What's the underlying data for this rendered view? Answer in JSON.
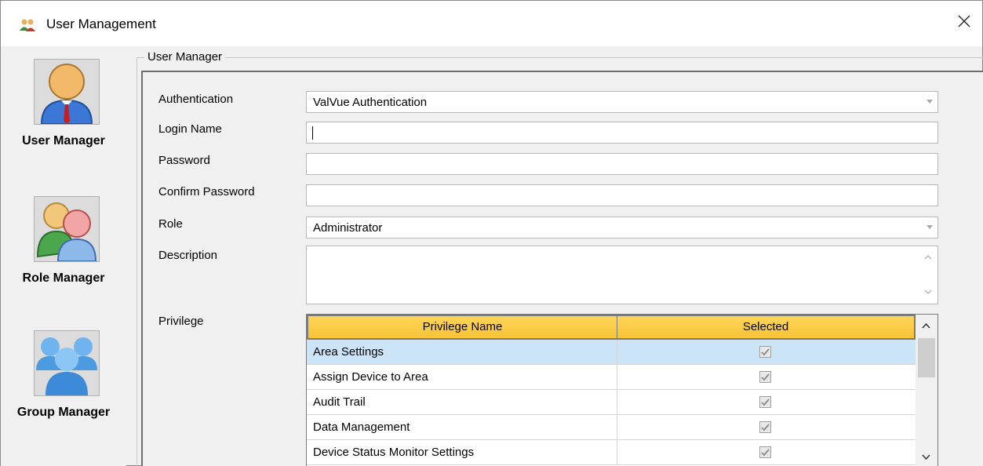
{
  "window": {
    "title": "User Management"
  },
  "sidebar": {
    "items": [
      {
        "label": "User Manager"
      },
      {
        "label": "Role Manager"
      },
      {
        "label": "Group Manager"
      }
    ]
  },
  "group": {
    "legend": "User Manager"
  },
  "form": {
    "authentication": {
      "label": "Authentication",
      "value": "ValVue Authentication"
    },
    "login_name": {
      "label": "Login Name",
      "value": ""
    },
    "password": {
      "label": "Password",
      "value": ""
    },
    "confirm_password": {
      "label": "Confirm Password",
      "value": ""
    },
    "role": {
      "label": "Role",
      "value": "Administrator"
    },
    "description": {
      "label": "Description",
      "value": ""
    },
    "privilege": {
      "label": "Privilege"
    }
  },
  "privileges": {
    "columns": [
      "Privilege Name",
      "Selected"
    ],
    "rows": [
      {
        "name": "Area Settings",
        "selected": true
      },
      {
        "name": "Assign Device to Area",
        "selected": true
      },
      {
        "name": "Audit Trail",
        "selected": true
      },
      {
        "name": "Data Management",
        "selected": true
      },
      {
        "name": "Device Status Monitor Settings",
        "selected": true
      }
    ]
  },
  "colors": {
    "header_gold": "#f7c337",
    "row_selected": "#cce4f7",
    "window_bg": "#f0f0f0"
  },
  "icons": {
    "app": "users-icon",
    "close": "close-icon",
    "user_manager": "user-tie-icon",
    "role_manager": "two-users-icon",
    "group_manager": "group-icon"
  }
}
